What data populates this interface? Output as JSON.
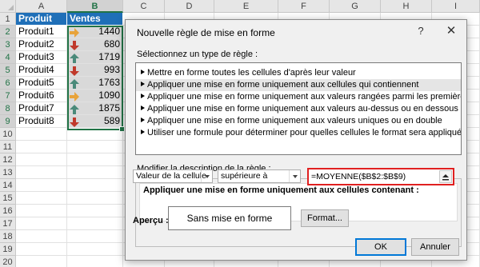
{
  "sheet": {
    "columns": [
      "A",
      "B",
      "C",
      "D",
      "E",
      "F",
      "G",
      "H",
      "I"
    ],
    "rows": [
      "1",
      "2",
      "3",
      "4",
      "5",
      "6",
      "7",
      "8",
      "9",
      "10",
      "11",
      "12",
      "13",
      "14",
      "15",
      "16",
      "17",
      "18",
      "19",
      "20"
    ],
    "header_produit": "Produit",
    "header_ventes": "Ventes",
    "data": [
      {
        "produit": "Produit1",
        "ventes": "1440",
        "icon": "arrow-right-icon"
      },
      {
        "produit": "Produit2",
        "ventes": "680",
        "icon": "arrow-down-icon"
      },
      {
        "produit": "Produit3",
        "ventes": "1719",
        "icon": "arrow-up-icon"
      },
      {
        "produit": "Produit4",
        "ventes": "993",
        "icon": "arrow-down-icon"
      },
      {
        "produit": "Produit5",
        "ventes": "1763",
        "icon": "arrow-up-icon"
      },
      {
        "produit": "Produit6",
        "ventes": "1090",
        "icon": "arrow-right-icon"
      },
      {
        "produit": "Produit7",
        "ventes": "1875",
        "icon": "arrow-up-icon"
      },
      {
        "produit": "Produit8",
        "ventes": "589",
        "icon": "arrow-down-icon"
      }
    ]
  },
  "dialog": {
    "title": "Nouvelle règle de mise en forme",
    "help": "?",
    "close": "✕",
    "select_type_label": "Sélectionnez un type de règle :",
    "rule_types": [
      "Mettre en forme toutes les cellules d'après leur valeur",
      "Appliquer une mise en forme uniquement aux cellules qui contiennent",
      "Appliquer une mise en forme uniquement aux valeurs rangées parmi les premières ou les dernières valeurs",
      "Appliquer une mise en forme uniquement aux valeurs au-dessus ou en dessous de la moyenne",
      "Appliquer une mise en forme uniquement aux valeurs uniques ou en double",
      "Utiliser une formule pour déterminer pour quelles cellules le format sera appliqué"
    ],
    "selected_rule_index": 1,
    "modify_label": "Modifier la description de la règle :",
    "apply_only_label": "Appliquer une mise en forme uniquement aux cellules contenant :",
    "condition_value": "Valeur de la cellule",
    "operator_value": "supérieure à",
    "formula_value": "=MOYENNE($B$2:$B$9)",
    "preview_label": "Aperçu :",
    "preview_text": "Sans mise en forme",
    "format_button": "Format...",
    "ok_button": "OK",
    "cancel_button": "Annuler"
  },
  "colors": {
    "header_fill": "#1f6fb8",
    "arrow_up": "#4a8a7a",
    "arrow_down": "#c0392b",
    "arrow_right": "#e8a33a",
    "selection": "#217346",
    "formula_border": "#e02020"
  }
}
